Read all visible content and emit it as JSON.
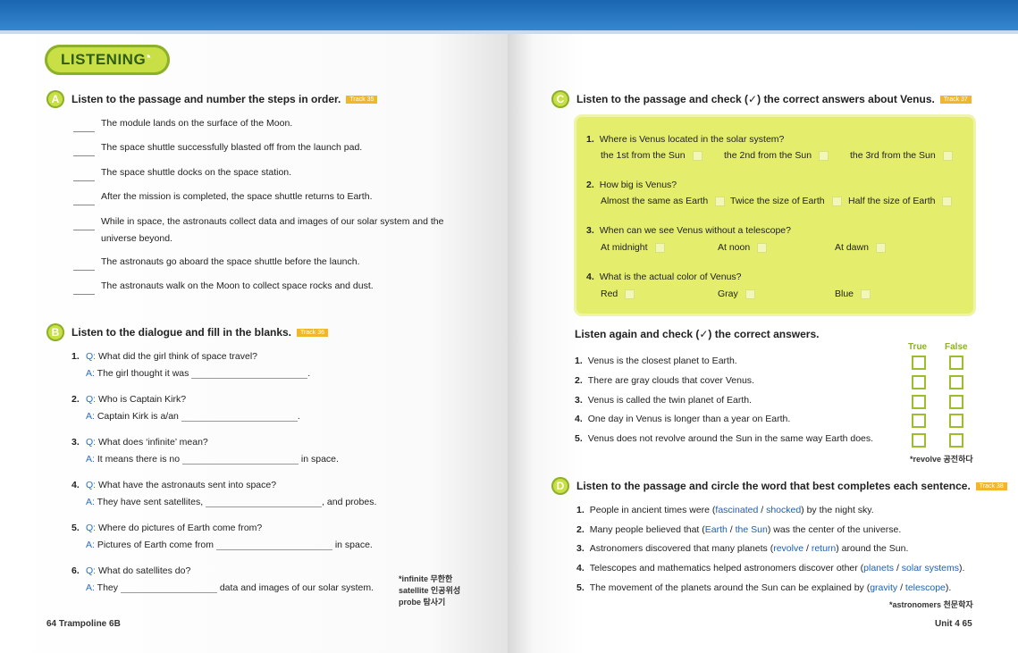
{
  "badge": {
    "label": "LISTENING"
  },
  "secA": {
    "letter": "A",
    "title": "Listen to the passage and number the steps in order.",
    "track": "Track 35"
  },
  "steps": [
    "The module lands on the surface of the Moon.",
    "The space shuttle successfully blasted off from the launch pad.",
    "The space shuttle docks on the space station.",
    "After the mission is completed, the space shuttle returns to Earth.",
    "While in space, the astronauts collect data and images of our solar system and the universe beyond.",
    "The astronauts go aboard the space shuttle before the launch.",
    "The astronauts walk on the Moon to collect space rocks and dust."
  ],
  "secB": {
    "letter": "B",
    "title": "Listen to the dialogue and fill in the blanks.",
    "track": "Track 36"
  },
  "qa": [
    {
      "num": "1.",
      "q_label": "Q:",
      "q": "What did the girl think of space travel?",
      "a_label": "A:",
      "a_pre": "The girl thought it was",
      "a_post": "."
    },
    {
      "num": "2.",
      "q_label": "Q:",
      "q": "Who is Captain Kirk?",
      "a_label": "A:",
      "a_pre": "Captain Kirk is a/an",
      "a_post": "."
    },
    {
      "num": "3.",
      "q_label": "Q:",
      "q": "What does ‘infinite’ mean?",
      "a_label": "A:",
      "a_pre": "It means there is no",
      "a_post": "in space."
    },
    {
      "num": "4.",
      "q_label": "Q:",
      "q": "What have the astronauts sent into space?",
      "a_label": "A:",
      "a_pre": "They have sent satellites,",
      "a_post": ", and probes."
    },
    {
      "num": "5.",
      "q_label": "Q:",
      "q": "Where do pictures of Earth come from?",
      "a_label": "A:",
      "a_pre": "Pictures of Earth come from",
      "a_post": "in space."
    },
    {
      "num": "6.",
      "q_label": "Q:",
      "q": "What do satellites do?",
      "a_label": "A:",
      "a_pre": "They",
      "a_post": "data and images of our solar system."
    }
  ],
  "gloss_left": [
    "*infinite 무한한",
    "satellite 인공위성",
    "probe 탐사기"
  ],
  "footer_left": "64 Trampoline 6B",
  "secC": {
    "letter": "C",
    "title": "Listen to the passage and check (✓) the correct answers about Venus.",
    "track": "Track 37"
  },
  "venus": [
    {
      "num": "1.",
      "q": "Where is Venus located in the solar system?",
      "opts": [
        "the 1st from the Sun",
        "the 2nd from the Sun",
        "the 3rd from the Sun"
      ]
    },
    {
      "num": "2.",
      "q": "How big is Venus?",
      "opts": [
        "Almost the same as Earth",
        "Twice the size of Earth",
        "Half the size of Earth"
      ]
    },
    {
      "num": "3.",
      "q": "When can we see Venus without a telescope?",
      "opts": [
        "At midnight",
        "At noon",
        "At dawn"
      ]
    },
    {
      "num": "4.",
      "q": "What is the actual color of Venus?",
      "opts": [
        "Red",
        "Gray",
        "Blue"
      ]
    }
  ],
  "again": {
    "title": "Listen again and check (✓) the correct answers.",
    "true_label": "True",
    "false_label": "False"
  },
  "tf": [
    {
      "num": "1.",
      "text": "Venus is the closest planet to Earth."
    },
    {
      "num": "2.",
      "text": "There are gray clouds that cover Venus."
    },
    {
      "num": "3.",
      "text": "Venus is called the twin planet of Earth."
    },
    {
      "num": "4.",
      "text": "One day in Venus is longer than a year on Earth."
    },
    {
      "num": "5.",
      "text": "Venus does not revolve around the Sun in the same way Earth does."
    }
  ],
  "gloss_revolve": "*revolve 공전하다",
  "secD": {
    "letter": "D",
    "title": "Listen to the passage and circle the word that best completes each sentence.",
    "track": "Track 38"
  },
  "circle": [
    {
      "num": "1.",
      "pre": "People in ancient times were (",
      "o1": "fascinated",
      "sep": " / ",
      "o2": "shocked",
      "post": ") by the night sky."
    },
    {
      "num": "2.",
      "pre": "Many people believed that (",
      "o1": "Earth",
      "sep": " / ",
      "o2": "the Sun",
      "post": ") was the center of the universe."
    },
    {
      "num": "3.",
      "pre": "Astronomers discovered that many planets (",
      "o1": "revolve",
      "sep": " / ",
      "o2": "return",
      "post": ") around the Sun."
    },
    {
      "num": "4.",
      "pre": "Telescopes and mathematics helped astronomers discover other (",
      "o1": "planets",
      "sep": " / ",
      "o2": "solar systems",
      "post": ")."
    },
    {
      "num": "5.",
      "pre": "The movement of the planets around the Sun can be explained by (",
      "o1": "gravity",
      "sep": " / ",
      "o2": "telescope",
      "post": ")."
    }
  ],
  "gloss_astronomers": "*astronomers 천문학자",
  "footer_right": "Unit 4  65"
}
